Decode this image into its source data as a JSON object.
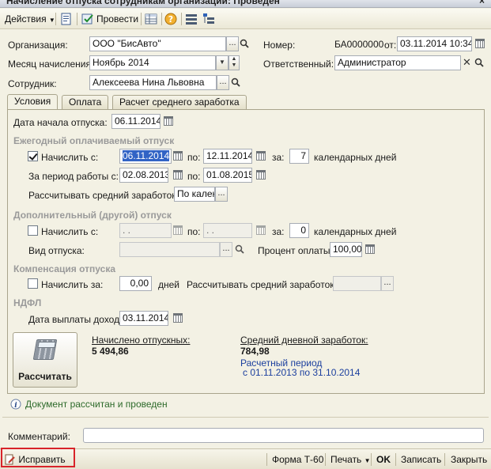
{
  "window": {
    "title": "Начисление отпуска сотрудникам организаций: Проведен",
    "close": "×"
  },
  "toolbar": {
    "actions_label": "Действия",
    "post_label": "Провести",
    "icons": [
      "document-icon",
      "post-icon",
      "table-icon",
      "help-icon",
      "list-icon",
      "tree-icon"
    ]
  },
  "header": {
    "org_label": "Организация:",
    "org_value": "ООО \"БисАвто\"",
    "month_label": "Месяц начисления:",
    "month_value": "Ноябрь 2014",
    "employee_label": "Сотрудник:",
    "employee_value": "Алексеева Нина Львовна",
    "number_label": "Номер:",
    "number_value": "БА0000000",
    "from_label": "от:",
    "date_value": "03.11.2014 10:34:",
    "responsible_label": "Ответственный:",
    "responsible_value": "Администратор"
  },
  "tabs": [
    {
      "label": "Условия",
      "active": true
    },
    {
      "label": "Оплата",
      "active": false
    },
    {
      "label": "Расчет среднего заработка",
      "active": false
    }
  ],
  "conditions": {
    "start_label": "Дата начала отпуска:",
    "start_value": "06.11.2014",
    "annual_title": "Ежегодный оплачиваемый отпуск",
    "annual_accrue_label": "Начислить с:",
    "annual_from": "06.11.2014",
    "to_label": "по:",
    "annual_to": "12.11.2014",
    "for_label": "за:",
    "annual_days": "7",
    "days_label": "календарных дней",
    "period_label": "За период работы с:",
    "period_from": "02.08.2013",
    "period_to": "01.08.2015",
    "avg_label": "Рассчитывать средний заработок:",
    "avg_value": "По кален",
    "extra_title": "Дополнительный (другой) отпуск",
    "extra_accrue_label": "Начислить с:",
    "extra_from": " .  .",
    "extra_to": " .  .",
    "extra_days": "0",
    "leave_type_label": "Вид отпуска:",
    "pay_percent_label": "Процент оплаты:",
    "pay_percent_value": "100,00",
    "comp_title": "Компенсация отпуска",
    "comp_accrue_label": "Начислить за:",
    "comp_days_value": "0,00",
    "comp_days_label": "дней",
    "comp_avg_label": "Рассчитывать средний заработок:",
    "ndfl_title": "НДФЛ",
    "income_date_label": "Дата выплаты дохода:",
    "income_date_value": "03.11.2014",
    "calc_button": "Рассчитать",
    "accrued_label": "Начислено отпускных:",
    "accrued_value": "5 494,86",
    "avg_daily_label": "Средний дневной заработок:",
    "avg_daily_value": "784,98",
    "calc_period_label": "Расчетный период",
    "calc_period_value": "с 01.11.2013 по 31.10.2014",
    "info_text": "Документ рассчитан и проведен"
  },
  "comment_label": "Комментарий:",
  "bottom": {
    "fix_label": "Исправить",
    "form_label": "Форма Т-60",
    "print_label": "Печать",
    "ok_label": "OK",
    "save_label": "Записать",
    "close_label": "Закрыть"
  }
}
